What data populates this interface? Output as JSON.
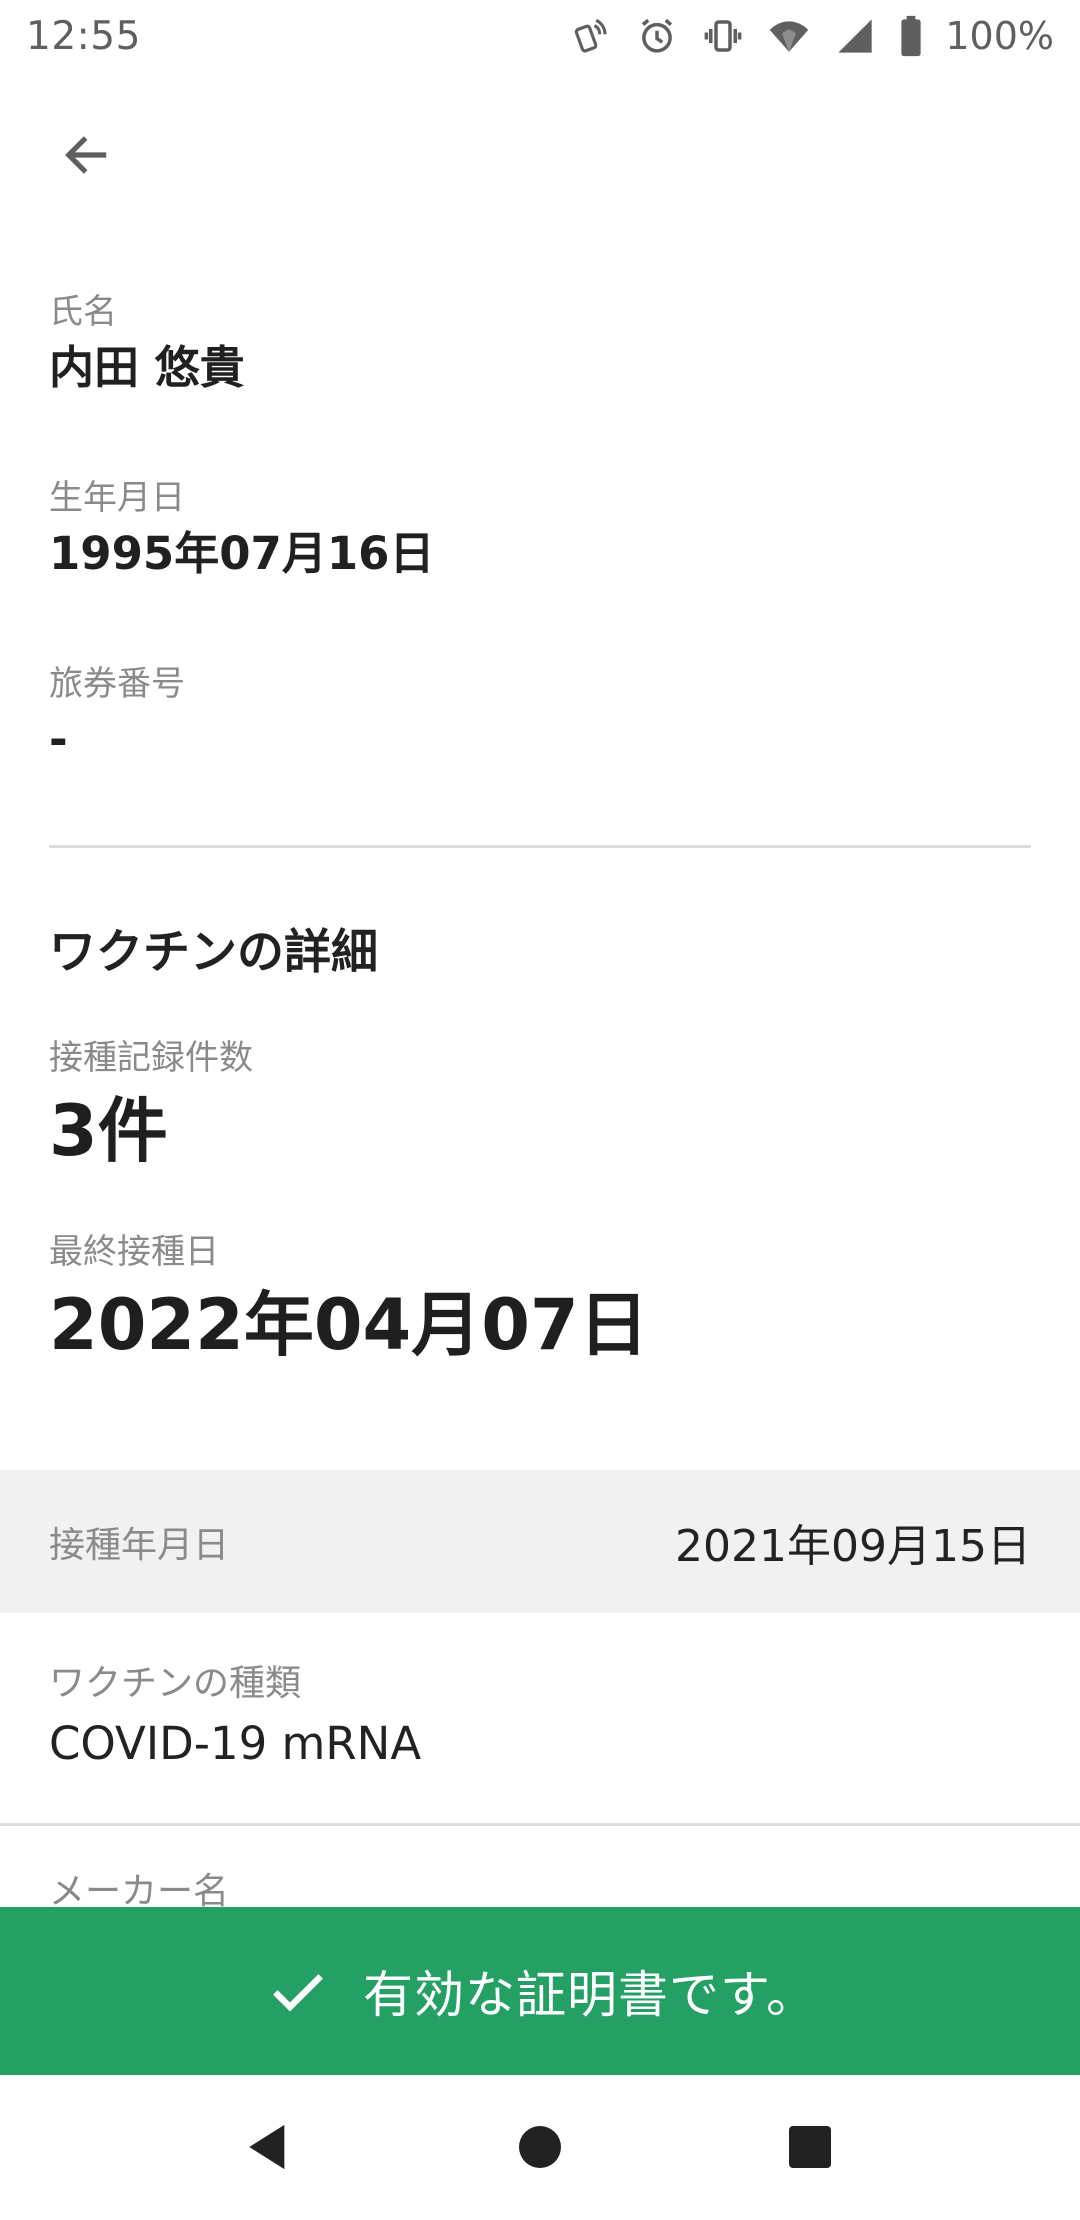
{
  "status_bar": {
    "time": "12:55",
    "battery_percent": "100%",
    "icons": [
      "nfc-icon",
      "alarm-icon",
      "vibrate-icon",
      "wifi-icon",
      "signal-icon",
      "battery-icon"
    ]
  },
  "profile": {
    "name_label": "氏名",
    "name_value": "内田 悠貴",
    "dob_label": "生年月日",
    "dob_value": "1995年07月16日",
    "passport_label": "旅券番号",
    "passport_value": "-"
  },
  "vaccine_details": {
    "section_title": "ワクチンの詳細",
    "count_label": "接種記録件数",
    "count_value": "3件",
    "last_date_label": "最終接種日",
    "last_date_value": "2022年04月07日"
  },
  "record": {
    "date_label": "接種年月日",
    "date_value": "2021年09月15日",
    "type_label": "ワクチンの種類",
    "type_value": "COVID-19 mRNA",
    "maker_label": "メーカー名"
  },
  "banner": {
    "text": "有効な証明書です。",
    "color": "#24a064"
  },
  "nav": {
    "buttons": [
      "back-triangle-icon",
      "home-circle-icon",
      "recents-square-icon"
    ]
  }
}
